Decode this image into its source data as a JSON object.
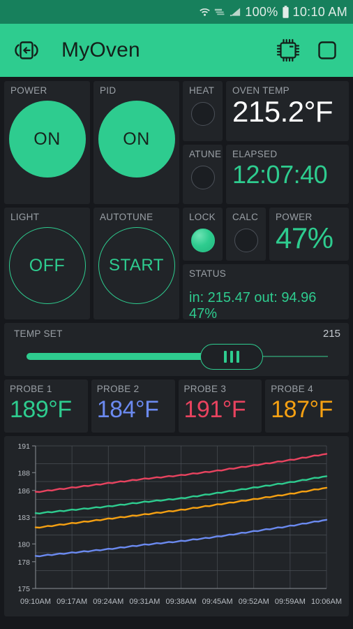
{
  "statusbar": {
    "icons": [
      "wifi-icon",
      "vpn-icon",
      "signal-icon",
      "battery-icon"
    ],
    "battery_text": "100%",
    "time_text": "10:10 AM"
  },
  "appbar": {
    "back_icon": "exit-door-icon",
    "title": "MyOven",
    "chip_icon": "cpu-chip-icon",
    "square_icon": "rounded-square-icon"
  },
  "controls": {
    "power": {
      "label": "POWER",
      "state": "ON"
    },
    "pid": {
      "label": "PID",
      "state": "ON"
    },
    "light": {
      "label": "LIGHT",
      "state": "OFF"
    },
    "autotune": {
      "label": "AUTOTUNE",
      "state": "START"
    },
    "heat": {
      "label": "HEAT",
      "lit": false
    },
    "atune": {
      "label": "ATUNE",
      "lit": false
    },
    "lock": {
      "label": "LOCK",
      "lit": true
    },
    "calc": {
      "label": "CALC",
      "lit": false
    }
  },
  "readouts": {
    "oven_temp": {
      "label": "OVEN TEMP",
      "value": "215.2°F"
    },
    "elapsed": {
      "label": "ELAPSED",
      "value": "12:07:40"
    },
    "power_pct": {
      "label": "POWER",
      "value": "47%"
    },
    "status": {
      "label": "STATUS",
      "value": "in: 215.47 out: 94.96 47%"
    }
  },
  "temp_set": {
    "label": "TEMP SET",
    "value": "215",
    "fill_percent": 68
  },
  "probes": [
    {
      "label": "PROBE 1",
      "value": "189°F",
      "color": "#2ecc8f"
    },
    {
      "label": "PROBE 2",
      "value": "184°F",
      "color": "#6b8af0"
    },
    {
      "label": "PROBE 3",
      "value": "191°F",
      "color": "#e8435f"
    },
    {
      "label": "PROBE 4",
      "value": "187°F",
      "color": "#f5a012"
    }
  ],
  "colors": {
    "accent": "#2ecc8f",
    "appbar": "#2ecc8f",
    "statusbar": "#17805c",
    "page_bg": "#16181c",
    "card_bg": "#212428",
    "label": "#9aa0a6"
  },
  "chart_data": {
    "type": "line",
    "title": "",
    "xlabel": "",
    "ylabel": "",
    "grid": true,
    "legend": "none",
    "ylim": [
      175,
      191
    ],
    "yticks": [
      191,
      188,
      186,
      183,
      180,
      178,
      175
    ],
    "xticks": [
      "09:10AM",
      "09:17AM",
      "09:24AM",
      "09:31AM",
      "09:38AM",
      "09:45AM",
      "09:52AM",
      "09:59AM",
      "10:06AM"
    ],
    "x": [
      "09:10AM",
      "09:17AM",
      "09:24AM",
      "09:31AM",
      "09:38AM",
      "09:45AM",
      "09:52AM",
      "09:59AM",
      "10:06AM"
    ],
    "series": [
      {
        "name": "PROBE 3",
        "color": "#e8435f",
        "values": [
          185.8,
          186.3,
          186.8,
          187.3,
          187.7,
          188.2,
          188.8,
          189.4,
          190.1
        ]
      },
      {
        "name": "PROBE 1",
        "color": "#2ecc8f",
        "values": [
          183.4,
          183.8,
          184.2,
          184.7,
          185.1,
          185.7,
          186.3,
          186.9,
          187.6
        ]
      },
      {
        "name": "PROBE 4",
        "color": "#f5a012",
        "values": [
          181.8,
          182.3,
          182.8,
          183.3,
          183.8,
          184.4,
          185.0,
          185.6,
          186.3
        ]
      },
      {
        "name": "PROBE 2",
        "color": "#6b8af0",
        "values": [
          178.6,
          179.0,
          179.4,
          179.9,
          180.3,
          180.8,
          181.4,
          182.0,
          182.7
        ]
      }
    ]
  }
}
